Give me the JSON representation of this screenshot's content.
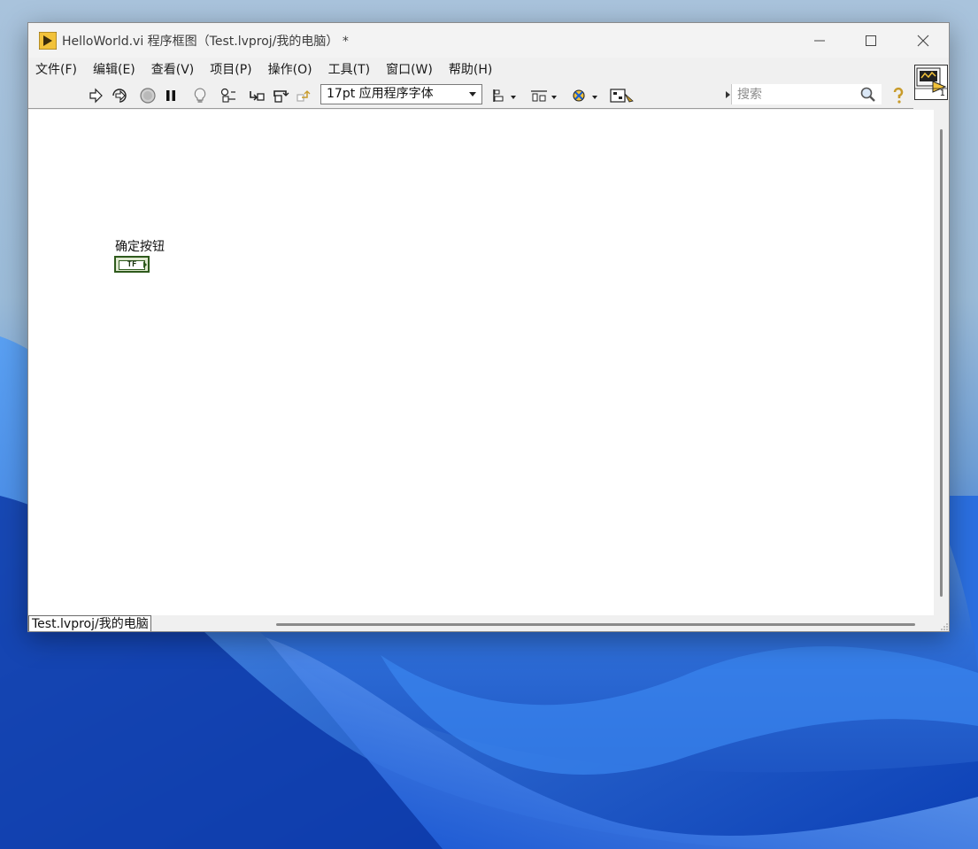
{
  "window": {
    "title": "HelloWorld.vi 程序框图（Test.lvproj/我的电脑） *",
    "controls": {
      "minimize": "minimize-icon",
      "maximize": "maximize-icon",
      "close": "close-icon"
    }
  },
  "menu": {
    "items": [
      {
        "label": "文件(F)"
      },
      {
        "label": "编辑(E)"
      },
      {
        "label": "查看(V)"
      },
      {
        "label": "项目(P)"
      },
      {
        "label": "操作(O)"
      },
      {
        "label": "工具(T)"
      },
      {
        "label": "窗口(W)"
      },
      {
        "label": "帮助(H)"
      }
    ]
  },
  "toolbar": {
    "icons": [
      "run-arrow-icon",
      "run-continuously-icon",
      "abort-icon",
      "pause-icon",
      "highlight-execution-icon",
      "retain-wire-values-icon",
      "step-into-icon",
      "step-over-icon",
      "step-out-icon",
      "align-objects-icon",
      "distribute-objects-icon",
      "reorder-icon",
      "cleanup-diagram-icon",
      "search-icon",
      "context-help-icon"
    ],
    "font_select": "17pt 应用程序字体",
    "search_placeholder": "搜索"
  },
  "diagram": {
    "control_label": "确定按钮",
    "terminal_text": "TF"
  },
  "status": {
    "path": "Test.lvproj/我的电脑"
  },
  "vi_icon": {
    "connector_number": "1"
  },
  "colors": {
    "terminal_border": "#2e5a1c",
    "wallpaper_blue": "#1346b8"
  }
}
